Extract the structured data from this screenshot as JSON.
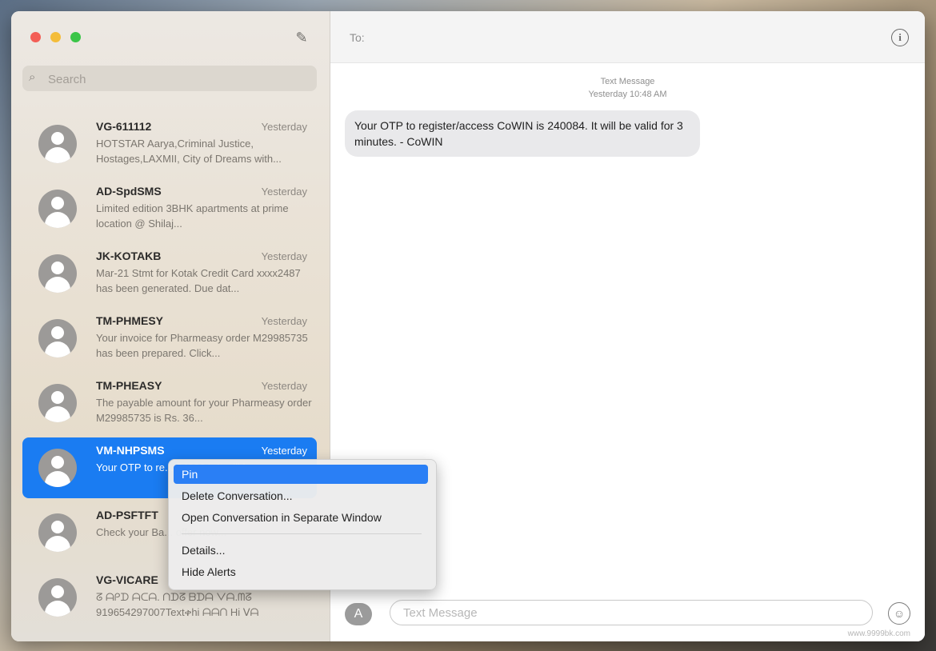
{
  "sidebar": {
    "search_placeholder": "Search",
    "conversations": [
      {
        "name": "VG-611112",
        "time": "Yesterday",
        "preview": "HOTSTAR Aarya,Criminal Justice, Hostages,LAXMII, City of Dreams with..."
      },
      {
        "name": "AD-SpdSMS",
        "time": "Yesterday",
        "preview": "Limited edition 3BHK apartments at prime location @ Shilaj..."
      },
      {
        "name": "JK-KOTAKB",
        "time": "Yesterday",
        "preview": "Mar-21 Stmt for Kotak Credit Card xxxx2487 has been generated. Due dat..."
      },
      {
        "name": "TM-PHMESY",
        "time": "Yesterday",
        "preview": "Your invoice for Pharmeasy order M29985735 has been prepared. Click..."
      },
      {
        "name": "TM-PHEASY",
        "time": "Yesterday",
        "preview": "The payable amount for your Pharmeasy order M29985735 is Rs. 36..."
      },
      {
        "name": "VM-NHPSMS",
        "time": "Yesterday",
        "preview": "Your OTP to re... 240084. It will b..."
      },
      {
        "name": "AD-PSFTFT",
        "time": "",
        "preview": "Check your Ba... offer now..."
      },
      {
        "name": "VG-VICARE",
        "time": "",
        "preview": "ᘔ ᗩᑭᗪ ᗩᑕᗩ. ᑎᗪᘔ ᗷᗪᗩ ᐯᗩ.ᗰᘔ 919654297007Textቀhi ᗩᗩᑎ Hi ᐯᗩ"
      }
    ]
  },
  "chat": {
    "to_label": "To:",
    "meta_type": "Text Message",
    "meta_time": "Yesterday 10:48 AM",
    "message": "Your OTP to register/access CoWIN is 240084. It will be valid for 3 minutes. - CoWIN",
    "input_placeholder": "Text Message"
  },
  "context_menu": {
    "items": [
      "Pin",
      "Delete Conversation...",
      "Open Conversation in Separate Window",
      "Details...",
      "Hide Alerts"
    ]
  },
  "watermark": "www.9999bk.com",
  "colors": {
    "selection": "#1a7cf2",
    "menu_highlight": "#2a7ff5"
  }
}
